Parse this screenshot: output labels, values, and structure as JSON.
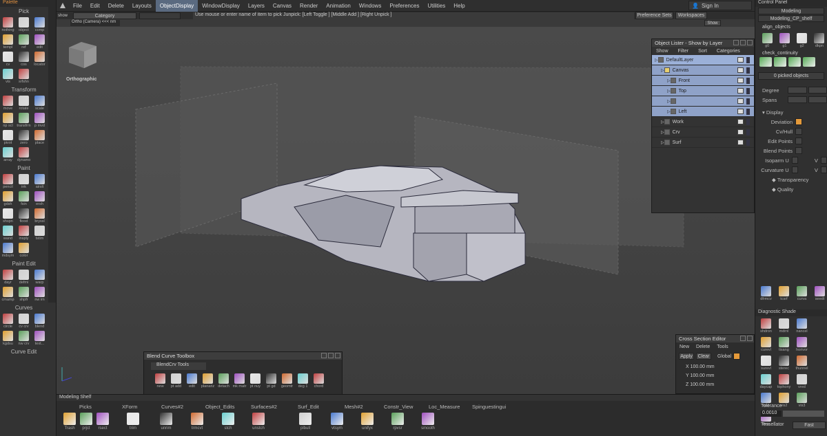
{
  "palette": {
    "title": "Palette",
    "pick": {
      "title": "Pick",
      "tools": [
        "nothing",
        "object",
        "comp",
        "templ",
        "ref",
        "edit",
        "cv",
        "cos",
        "locator",
        "vis",
        "srfshn"
      ]
    },
    "transform": {
      "title": "Transform",
      "tools": [
        "move",
        "rotate",
        "scale",
        "np scl",
        "transfrm",
        "p mvd",
        "pivot",
        "zero",
        "place",
        "array",
        "dynamo"
      ]
    },
    "paint": {
      "title": "Paint",
      "tools": [
        "pencil",
        "ink",
        "airslt",
        "gdsh",
        "fsin",
        "ersh",
        "shspn",
        "flood",
        "bryssl",
        "wand",
        "insply",
        "tstim",
        "mdsym",
        "color"
      ]
    },
    "paintedit": {
      "title": "Paint Edit",
      "tools": [
        "dayr",
        "defmi",
        "warp",
        "cmamp",
        "shpfr",
        "nw im"
      ]
    },
    "curves": {
      "title": "Curves",
      "tools": [
        "circle",
        "cv crv",
        "blend",
        "kgdsu",
        "nw crv",
        "text..."
      ]
    },
    "curveedit": {
      "title": "Curve Edit"
    }
  },
  "menu": {
    "items": [
      "File",
      "Edit",
      "Delete",
      "Layouts",
      "ObjectDisplay",
      "WindowDisplay",
      "Layers",
      "Canvas",
      "Render",
      "Animation",
      "Windows",
      "Preferences",
      "Utilities",
      "Help"
    ],
    "active": "ObjectDisplay",
    "signin": "Sign In"
  },
  "toolbar": {
    "show": "show",
    "category": "Category",
    "hint": "Use mouse or enter name of item to pick  Junpick: [Left Toggle ] [Middle Add ] [Right Unpick ]",
    "prefsets": "Preference Sets",
    "workspaces": "Workspaces",
    "showbtn": "Show",
    "camera": "Ortho (Camera) <<< nm"
  },
  "viewport": {
    "label": "Orthographic"
  },
  "rightpanel": {
    "title": "Control Panel",
    "mode": "Modeling",
    "sub": "Modeling_CP_shelf",
    "align_objects": "align_objects",
    "align_tools": [
      "g0",
      "g1",
      "g2",
      "dkpn"
    ],
    "check_continuity": "check_continuity",
    "picked": "0 picked objects",
    "degree": "Degree",
    "spans": "Spans",
    "display": "Display",
    "display_items": [
      {
        "label": "Deviation",
        "on": true
      },
      {
        "label": "Cv/Hull",
        "on": false
      },
      {
        "label": "Edit Points",
        "on": false
      },
      {
        "label": "Blend Points",
        "on": false
      },
      {
        "label": "Isoparm U",
        "on": false
      },
      {
        "label": "Curvature U",
        "on": false
      }
    ],
    "v_label": "V",
    "transparency": "Transparency",
    "quality": "Quality",
    "bottom_tools": [
      "dfrmcv",
      "tcsrf",
      "curva",
      "seedt"
    ],
    "diag": "Diagnostic Shade",
    "diag_tools": [
      "shdron",
      "mdrnl",
      "nancel",
      "curevl",
      "tisang",
      "horivor",
      "surevl",
      "sterec",
      "thunnel",
      "daycap",
      "tophony",
      "vred",
      "vis1",
      "vis2",
      "vis3",
      "fllesr"
    ],
    "tolerance": "Tolerance",
    "tol_value": "0.0010",
    "tessellator": "Tessellator",
    "tess_value": "Fast"
  },
  "lister": {
    "title": "Object Lister - Show by Layer",
    "menus": [
      "Show",
      "Filter",
      "Sort",
      "Categories"
    ],
    "rows": [
      {
        "name": "DefaultLayer",
        "style": "sel2",
        "indent": 0
      },
      {
        "name": "Canvas",
        "style": "sel",
        "indent": 1
      },
      {
        "name": "Front",
        "style": "sel",
        "indent": 2
      },
      {
        "name": "Top",
        "style": "sel",
        "indent": 2
      },
      {
        "name": "",
        "style": "sel",
        "indent": 2
      },
      {
        "name": "Left",
        "style": "sel",
        "indent": 2
      },
      {
        "name": "Work",
        "style": "",
        "indent": 1
      },
      {
        "name": "Crv",
        "style": "",
        "indent": 1
      },
      {
        "name": "Surf",
        "style": "",
        "indent": 1
      }
    ]
  },
  "blend": {
    "title": "Blend Curve Toolbox",
    "tab": "BlendCrv Tools",
    "tools": [
      "new",
      "pt add",
      "edit",
      "planariz",
      "detach",
      "mk matr",
      "pt nuy",
      "pt gd",
      "geomtr",
      "deg 1",
      "chord"
    ]
  },
  "cross": {
    "title": "Cross Section Editor",
    "menus": [
      "New",
      "Delete",
      "Tools"
    ],
    "apply": "Apply",
    "clear": "Clear",
    "global": "Global",
    "x": "X 100.00 mm",
    "y": "Y 100.00 mm",
    "z": "Z 100.00 mm"
  },
  "shelf": {
    "title": "Modeling Shelf",
    "tabs": [
      "Picks",
      "XForm",
      "Curves#2",
      "Object_Edits",
      "Surfaces#2",
      "Surf_Edit",
      "Mesh#2",
      "Constr_View",
      "Loc_Measure",
      "Spinguestingui"
    ],
    "items": [
      "Trash",
      "prjct",
      "rsect",
      "trim",
      "unrim",
      "trmcvt",
      "stch",
      "unstch",
      "plbull",
      "vtsym",
      "unifyx",
      "rpvsr",
      "smooth"
    ]
  }
}
